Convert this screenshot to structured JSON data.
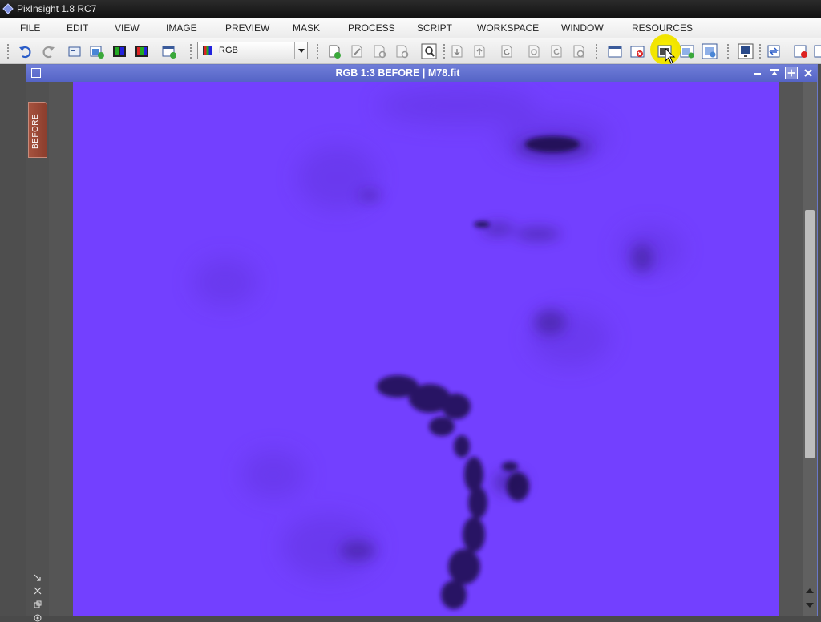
{
  "app": {
    "title": "PixInsight 1.8 RC7"
  },
  "menu": {
    "items": [
      "FILE",
      "EDIT",
      "VIEW",
      "IMAGE",
      "PREVIEW",
      "MASK",
      "PROCESS",
      "SCRIPT",
      "WORKSPACE",
      "WINDOW",
      "RESOURCES"
    ]
  },
  "toolbar": {
    "view_selector": "RGB"
  },
  "image_window": {
    "title": "RGB 1:3 BEFORE | M78.fit",
    "tab_label": "BEFORE",
    "background_color": "#7340ff"
  },
  "colors": {
    "title_bar": "#5d6bcc",
    "highlight": "#f1e400",
    "before_tab": "#9a4634"
  }
}
